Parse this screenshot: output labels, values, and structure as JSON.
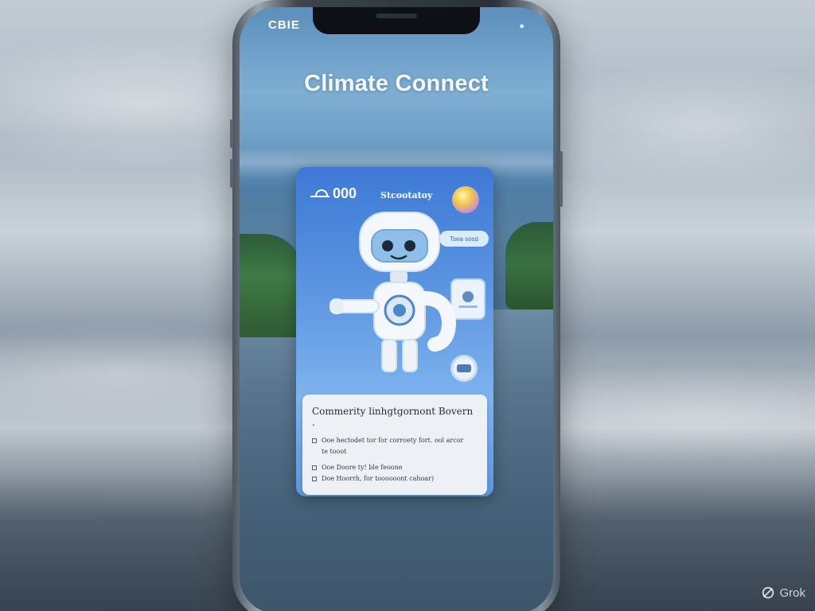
{
  "status_bar": {
    "carrier": "CBIE"
  },
  "app": {
    "title": "Climate Connect"
  },
  "card": {
    "count": "000",
    "label": "Stcootatoy",
    "bubble_text": "Tsea sosd",
    "panel": {
      "heading": "Commerity linhgtgornont Bovern .",
      "items": [
        "Ooe hectodet tor for corroety fort. ool arcor",
        "te tooot",
        "Ooe Doore ty! ble feoone",
        "Doe Hoorrh, for toooooont cahoar)"
      ]
    }
  },
  "watermark": {
    "text": "Grok"
  }
}
